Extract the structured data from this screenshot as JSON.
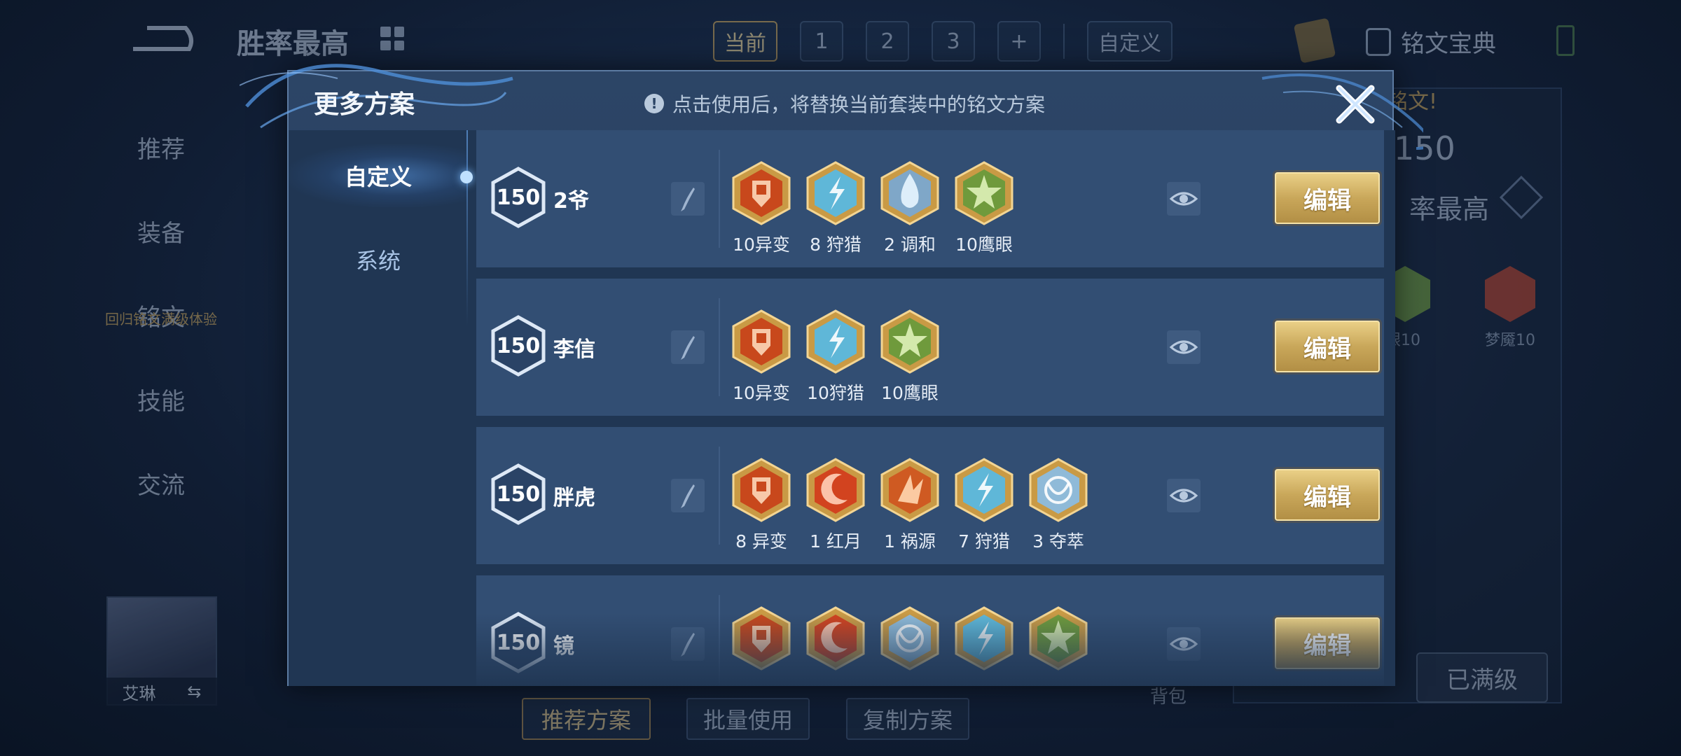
{
  "background": {
    "page_title": "胜率最高",
    "top_tabs": [
      "当前",
      "1",
      "2",
      "3",
      "+"
    ],
    "custom_tab": "自定义",
    "rune_dict": "铭文宝典",
    "side_menu": [
      "推荐",
      "装备",
      "铭文",
      "技能",
      "交流"
    ],
    "side_menu_sub": "回归铭文满级体验",
    "right_panel_tag": "铭文!",
    "right_panel_level": "150",
    "right_panel_title": "率最高",
    "right_runes": [
      {
        "label": "眼10",
        "color": "#6f9a3c"
      },
      {
        "label": "梦魇10",
        "color": "#b3432e"
      }
    ],
    "hero_name": "艾琳",
    "bottom_buttons": [
      "推荐方案",
      "批量使用",
      "复制方案"
    ],
    "bag": "背包",
    "maxed_button": "已满级"
  },
  "modal": {
    "title": "更多方案",
    "notice": "点击使用后，将替换当前套装中的铭文方案",
    "tabs": [
      {
        "label": "自定义",
        "active": true
      },
      {
        "label": "系统",
        "active": false
      }
    ],
    "edit_label": "编辑",
    "plans": [
      {
        "level": "150",
        "name": "2爷",
        "runes": [
          {
            "name": "异变",
            "count": "10异变",
            "icon": "red-shield-rune",
            "color": "#c8481c"
          },
          {
            "name": "狩猎",
            "count": "8 狩猎",
            "icon": "blue-lightning-rune",
            "color": "#5fb7d8"
          },
          {
            "name": "调和",
            "count": "2 调和",
            "icon": "blue-drop-rune",
            "color": "#7fa7c8"
          },
          {
            "name": "鹰眼",
            "count": "10鹰眼",
            "icon": "green-star-rune",
            "color": "#6f9a3c"
          }
        ]
      },
      {
        "level": "150",
        "name": "李信",
        "runes": [
          {
            "name": "异变",
            "count": "10异变",
            "icon": "red-shield-rune",
            "color": "#c8481c"
          },
          {
            "name": "狩猎",
            "count": "10狩猎",
            "icon": "blue-lightning-rune",
            "color": "#5fb7d8"
          },
          {
            "name": "鹰眼",
            "count": "10鹰眼",
            "icon": "green-star-rune",
            "color": "#6f9a3c"
          }
        ]
      },
      {
        "level": "150",
        "name": "胖虎",
        "runes": [
          {
            "name": "异变",
            "count": "8 异变",
            "icon": "red-shield-rune",
            "color": "#c8481c"
          },
          {
            "name": "红月",
            "count": "1 红月",
            "icon": "red-moon-rune",
            "color": "#d2431f"
          },
          {
            "name": "祸源",
            "count": "1 祸源",
            "icon": "red-spike-rune",
            "color": "#cf5a22"
          },
          {
            "name": "狩猎",
            "count": "7 狩猎",
            "icon": "blue-lightning-rune",
            "color": "#5fb7d8"
          },
          {
            "name": "夺萃",
            "count": "3 夺萃",
            "icon": "blue-knot-rune",
            "color": "#8fbad8"
          }
        ]
      },
      {
        "level": "150",
        "name": "镜",
        "runes": [
          {
            "name": "异变",
            "count": "",
            "icon": "red-shield-rune",
            "color": "#c8481c"
          },
          {
            "name": "红月",
            "count": "",
            "icon": "red-moon-rune",
            "color": "#d2431f"
          },
          {
            "name": "夺萃",
            "count": "",
            "icon": "blue-knot-rune",
            "color": "#8fbad8"
          },
          {
            "name": "狩猎",
            "count": "",
            "icon": "blue-lightning-rune",
            "color": "#5fb7d8"
          },
          {
            "name": "鹰眼",
            "count": "",
            "icon": "green-star-rune",
            "color": "#6f9a3c"
          }
        ]
      }
    ]
  }
}
